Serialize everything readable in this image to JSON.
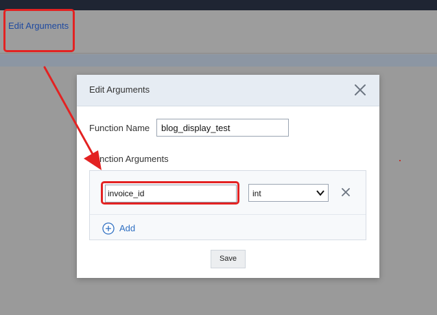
{
  "background": {
    "link_label": "Edit Arguments"
  },
  "modal": {
    "title": "Edit Arguments",
    "close_icon": "close-icon",
    "function_name_label": "Function Name",
    "function_name_value": "blog_display_test",
    "function_arguments_label": "Function Arguments",
    "arguments": [
      {
        "name": "invoice_id",
        "type": "int"
      }
    ],
    "add_label": "Add",
    "add_icon": "plus-circle-icon",
    "save_label": "Save"
  },
  "annotation": {
    "color": "#e32222"
  }
}
